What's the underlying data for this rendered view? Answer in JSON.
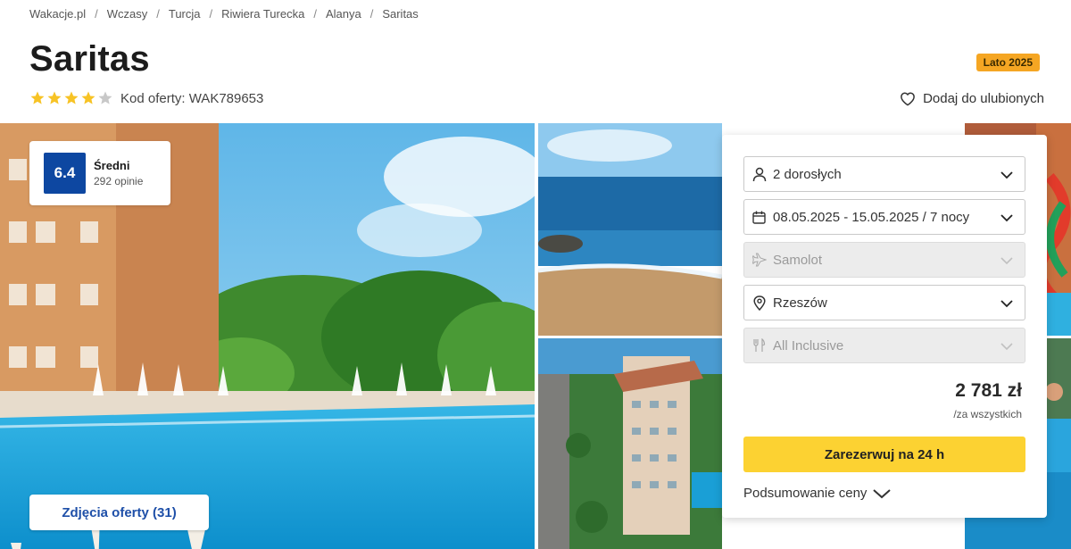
{
  "breadcrumb": [
    "Wakacje.pl",
    "Wczasy",
    "Turcja",
    "Riwiera Turecka",
    "Alanya",
    "Saritas"
  ],
  "hotel": {
    "name": "Saritas",
    "stars": 4,
    "max_stars": 5,
    "offer_code": "Kod oferty: WAK789653",
    "season_badge": "Lato 2025",
    "favorite_label": "Dodaj do ulubionych"
  },
  "rating": {
    "score": "6.4",
    "label": "Średni",
    "count": "292 opinie"
  },
  "gallery": {
    "photos_button": "Zdjęcia oferty (31)"
  },
  "booking": {
    "travellers": "2 dorosłych",
    "dates": "08.05.2025 - 15.05.2025 / 7 nocy",
    "transport": "Samolot",
    "departure": "Rzeszów",
    "board": "All Inclusive",
    "price": "2 781 zł",
    "price_note": "/za wszystkich",
    "book_button": "Zarezerwuj na 24 h",
    "summary_label": "Podsumowanie ceny"
  },
  "colors": {
    "rating_bg": "#0d47a1",
    "badge_bg": "#f5a623",
    "book_button_bg": "#fcd232",
    "star_filled": "#f7c325",
    "star_empty": "#c8c8c8",
    "link": "#1e4fa8"
  },
  "icons": [
    "star-icon",
    "heart-icon",
    "person-icon",
    "calendar-icon",
    "plane-icon",
    "location-pin-icon",
    "cutlery-icon",
    "chevron-down-icon"
  ]
}
